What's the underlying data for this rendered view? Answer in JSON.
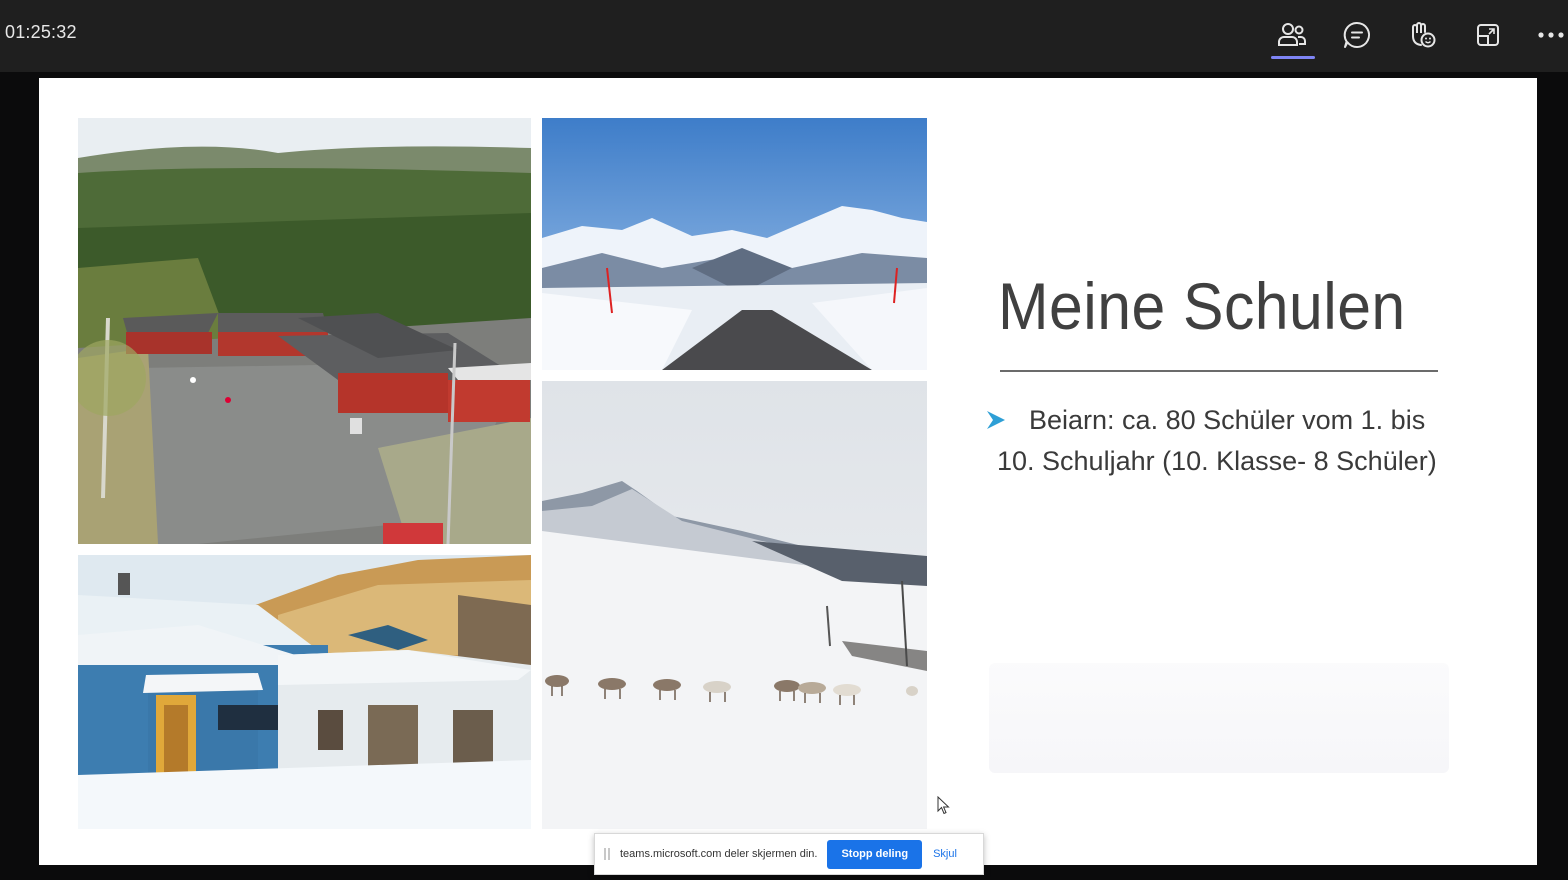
{
  "meeting": {
    "timer": "01:25:32"
  },
  "toolbar": {
    "items": [
      {
        "name": "people",
        "icon": "people-icon"
      },
      {
        "name": "chat",
        "icon": "chat-icon"
      },
      {
        "name": "react",
        "icon": "raise-hand-react-icon"
      },
      {
        "name": "view",
        "icon": "view-layout-icon"
      },
      {
        "name": "more",
        "icon": "more-options-icon"
      }
    ],
    "active": "people"
  },
  "slide": {
    "title": "Meine Schulen",
    "bullets": [
      "Beiarn: ca. 80 Schüler vom 1. bis 10. Schuljahr (10. Klasse- 8 Schüler)"
    ],
    "bullet_color": "#2e9fd6",
    "photos": [
      {
        "name": "school-aerial-photo",
        "description_icon": "photo"
      },
      {
        "name": "mountain-road-photo",
        "description_icon": "photo"
      },
      {
        "name": "blue-school-building-photo",
        "description_icon": "photo"
      },
      {
        "name": "reindeer-snow-photo",
        "description_icon": "photo"
      }
    ]
  },
  "sharebar": {
    "message": "teams.microsoft.com deler skjermen din.",
    "stop_label": "Stopp deling",
    "hide_label": "Skjul",
    "accent": "#1a73e8"
  }
}
